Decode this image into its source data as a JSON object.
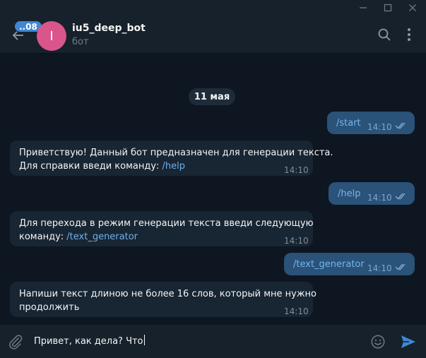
{
  "window": {
    "minimize_glyph": "–",
    "maximize_glyph": "☐",
    "close_glyph": "✕"
  },
  "header": {
    "unread_count": "..08",
    "avatar_letter": "I",
    "chat_name": "iu5_deep_bot",
    "chat_status": "бот",
    "avatar_color": "#d9558b"
  },
  "date_label": "11 мая",
  "messages": [
    {
      "dir": "out",
      "text": "/start",
      "time": "14:10"
    },
    {
      "dir": "in",
      "line1": "Приветствую! Данный бот предназначен для генерации текста.",
      "line2_prefix": "Для справки введи команду: ",
      "line2_cmd": "/help",
      "time": "14:10"
    },
    {
      "dir": "out",
      "text": "/help",
      "time": "14:10"
    },
    {
      "dir": "in",
      "line1": "Для перехода в режим генерации текста введи следующую",
      "line2_prefix": "команду: ",
      "line2_cmd": "/text_generator",
      "time": "14:10"
    },
    {
      "dir": "out",
      "text": "/text_generator",
      "time": "14:10"
    },
    {
      "dir": "in",
      "line1": "Напиши текст длиною не более 16 слов, который мне нужно",
      "line2_prefix": "продолжить",
      "line2_cmd": "",
      "time": "14:10"
    }
  ],
  "composer": {
    "value": "Привет, как дела? Что"
  },
  "colors": {
    "accent": "#3e88d3",
    "link": "#70b0ea",
    "background": "#0e1621",
    "panel": "#17212b"
  }
}
